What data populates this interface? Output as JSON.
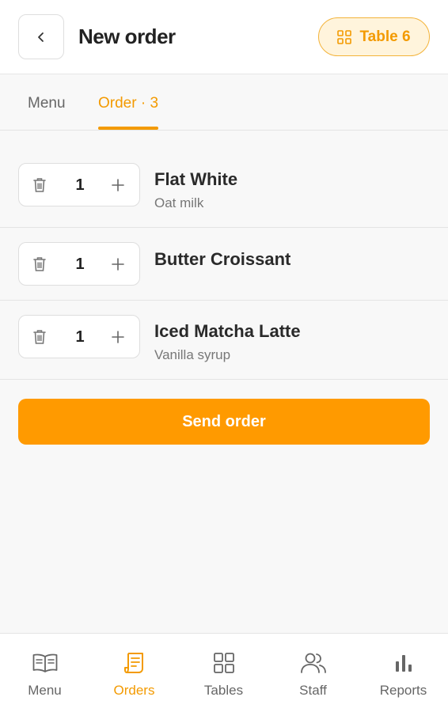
{
  "header": {
    "title": "New order",
    "table_badge": "Table 6"
  },
  "tabs": [
    {
      "label": "Menu",
      "active": false
    },
    {
      "label": "Order · 3",
      "active": true
    }
  ],
  "order_items": [
    {
      "qty": "1",
      "name": "Flat White",
      "modifier": "Oat milk"
    },
    {
      "qty": "1",
      "name": "Butter Croissant",
      "modifier": ""
    },
    {
      "qty": "1",
      "name": "Iced Matcha Latte",
      "modifier": "Vanilla syrup"
    }
  ],
  "send_button": "Send order",
  "bottom_nav": [
    {
      "label": "Menu",
      "icon": "book-icon",
      "active": false
    },
    {
      "label": "Orders",
      "icon": "receipt-icon",
      "active": true
    },
    {
      "label": "Tables",
      "icon": "grid-icon",
      "active": false
    },
    {
      "label": "Staff",
      "icon": "users-icon",
      "active": false
    },
    {
      "label": "Reports",
      "icon": "bar-chart-icon",
      "active": false
    }
  ],
  "colors": {
    "accent": "#ff9a00",
    "accent_text": "#f39a00",
    "badge_bg": "#fff4dc",
    "text": "#2a2a2a",
    "muted": "#777777"
  }
}
